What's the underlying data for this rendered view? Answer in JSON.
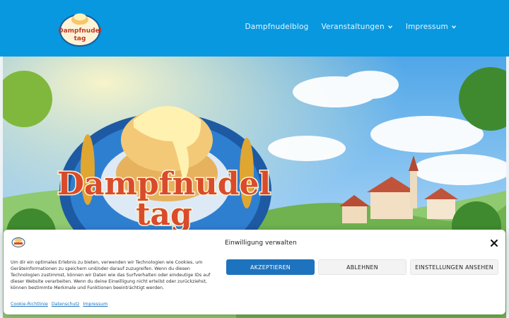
{
  "header": {
    "logo_text_top": "Dampfnudel",
    "logo_text_bottom": "tag",
    "nav": [
      {
        "label": "Dampfnudelblog"
      },
      {
        "label": "Veranstaltungen",
        "has_dropdown": true
      },
      {
        "label": "Impressum",
        "has_dropdown": true
      }
    ]
  },
  "hero": {
    "title_top": "Dampfnudel",
    "title_bottom": "tag"
  },
  "consent": {
    "title": "Einwilligung verwalten",
    "text": "Um dir ein optimales Erlebnis zu bieten, verwenden wir Technologien wie Cookies, um Geräteinformationen zu speichern und/oder darauf zuzugreifen. Wenn du diesen Technologien zustimmst, können wir Daten wie das Surfverhalten oder eindeutige IDs auf dieser Website verarbeiten. Wenn du deine Einwilligung nicht erteilst oder zurückziehst, können bestimmte Merkmale und Funktionen beeinträchtigt werden.",
    "accept": "AKZEPTIEREN",
    "deny": "ABLEHNEN",
    "preferences": "EINSTELLUNGEN ANSEHEN",
    "links": [
      "Cookie-Richtlinie",
      "Datenschutz",
      "Impressum"
    ]
  },
  "colors": {
    "header_bg": "#0798e0",
    "accent": "#1e73be"
  }
}
